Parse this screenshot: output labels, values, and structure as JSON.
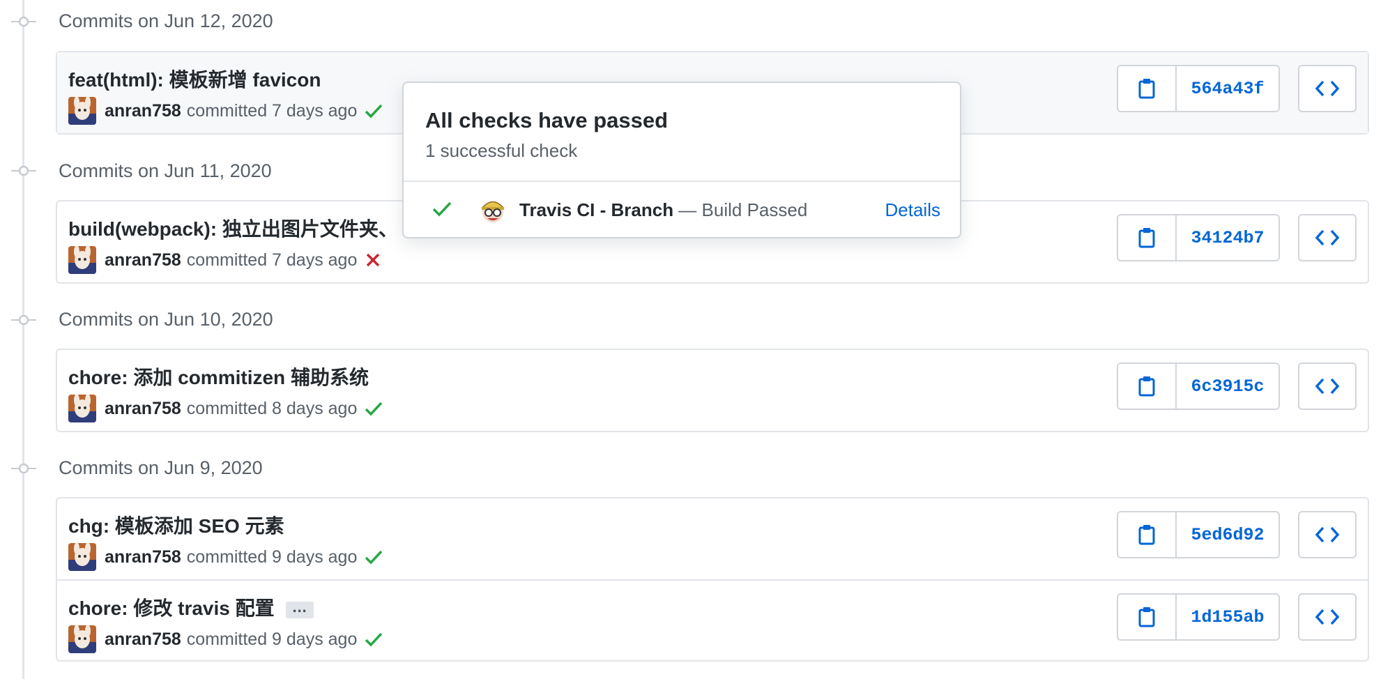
{
  "groups": [
    {
      "title": "Commits on Jun 12, 2020",
      "commits": [
        {
          "message": "feat(html): 模板新增 favicon",
          "author": "anran758",
          "time": "committed 7 days ago",
          "status": "success",
          "sha": "564a43f"
        }
      ]
    },
    {
      "title": "Commits on Jun 11, 2020",
      "commits": [
        {
          "message": "build(webpack): 独立出图片文件夹、",
          "author": "anran758",
          "time": "committed 7 days ago",
          "status": "failure",
          "sha": "34124b7"
        }
      ]
    },
    {
      "title": "Commits on Jun 10, 2020",
      "commits": [
        {
          "message": "chore: 添加 commitizen 辅助系统",
          "author": "anran758",
          "time": "committed 8 days ago",
          "status": "success",
          "sha": "6c3915c"
        }
      ]
    },
    {
      "title": "Commits on Jun 9, 2020",
      "commits": [
        {
          "message": "chg: 模板添加 SEO 元素",
          "author": "anran758",
          "time": "committed 9 days ago",
          "status": "success",
          "sha": "5ed6d92"
        },
        {
          "message": "chore: 修改 travis 配置",
          "author": "anran758",
          "time": "committed 9 days ago",
          "status": "success",
          "sha": "1d155ab",
          "ellipsis": "…"
        }
      ]
    }
  ],
  "popover": {
    "title": "All checks have passed",
    "subtitle": "1 successful check",
    "check_name": "Travis CI - Branch",
    "check_status": " — Build Passed",
    "details_label": "Details"
  },
  "colors": {
    "success": "#28a745",
    "failure": "#cb2431",
    "link": "#0366d6",
    "muted": "#586069"
  }
}
